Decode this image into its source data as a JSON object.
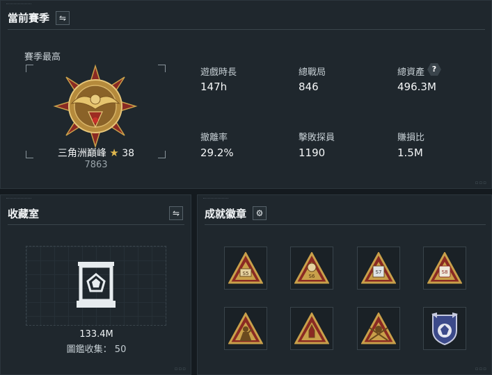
{
  "season": {
    "title": "當前賽季",
    "best_label": "賽季最高",
    "rank_name": "三角洲巔峰",
    "rank_stars": "38",
    "rank_points": "7863",
    "stats": [
      {
        "label": "遊戲時長",
        "value": "147h"
      },
      {
        "label": "總戰局",
        "value": "846"
      },
      {
        "label": "總資產",
        "value": "496.3M",
        "help": "?"
      },
      {
        "label": "撤離率",
        "value": "29.2%"
      },
      {
        "label": "擊敗探員",
        "value": "1190"
      },
      {
        "label": "賺損比",
        "value": "1.5M"
      }
    ]
  },
  "collection": {
    "title": "收藏室",
    "value": "133.4M",
    "count_label": "圖鑑收集：",
    "count_value": "50"
  },
  "achievements": {
    "title": "成就徽章",
    "badges": [
      {
        "icon": "season-5-badge-icon",
        "text": "S5"
      },
      {
        "icon": "season-6-badge-icon",
        "text": "S6"
      },
      {
        "icon": "season-7-badge-icon",
        "text": "S7"
      },
      {
        "icon": "season-8-badge-icon",
        "text": "S8"
      },
      {
        "icon": "soldier-salute-badge-icon",
        "text": ""
      },
      {
        "icon": "rocket-badge-icon",
        "text": ""
      },
      {
        "icon": "crossed-swords-badge-icon",
        "text": ""
      },
      {
        "icon": "shield-emblem-badge-icon",
        "text": ""
      }
    ]
  },
  "colors": {
    "badge_gold": "#c9a04a",
    "badge_red": "#8a2a23",
    "shield_blue": "#3c4a8a"
  }
}
